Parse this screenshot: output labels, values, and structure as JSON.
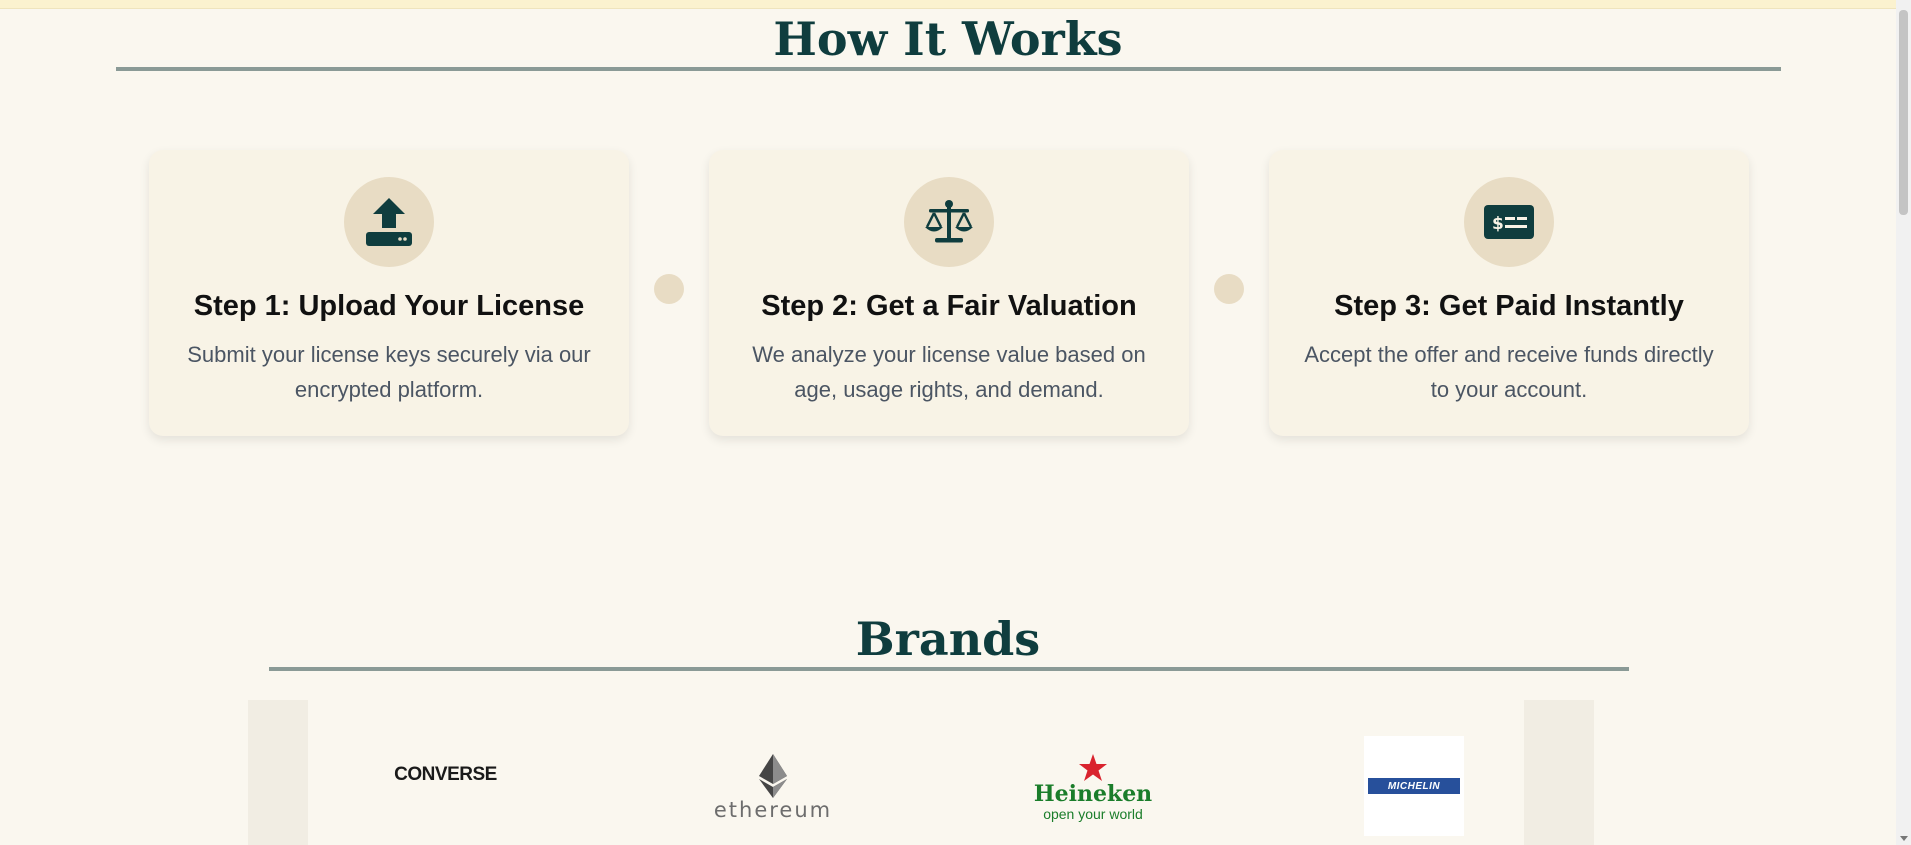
{
  "how_it_works": {
    "title": "How It Works",
    "steps": [
      {
        "icon": "upload-icon",
        "title": "Step 1: Upload Your License",
        "description": "Submit your license keys securely via our encrypted platform."
      },
      {
        "icon": "scale-icon",
        "title": "Step 2: Get a Fair Valuation",
        "description": "We analyze your license value based on age, usage rights, and demand."
      },
      {
        "icon": "money-bill-icon",
        "title": "Step 3: Get Paid Instantly",
        "description": "Accept the offer and receive funds directly to your account."
      }
    ]
  },
  "brands": {
    "title": "Brands",
    "logos": [
      {
        "name": "Converse",
        "text": "CONVERSE"
      },
      {
        "name": "Ethereum",
        "text": "ethereum"
      },
      {
        "name": "Heineken",
        "text": "Heineken",
        "tagline": "open your world"
      },
      {
        "name": "Michelin",
        "text": "MICHELIN"
      }
    ]
  },
  "colors": {
    "background": "#faf7ef",
    "heading": "#0f3d3e",
    "card": "#f8f3e6",
    "accent": "#e8dcc4",
    "rule": "#8a9a96"
  }
}
